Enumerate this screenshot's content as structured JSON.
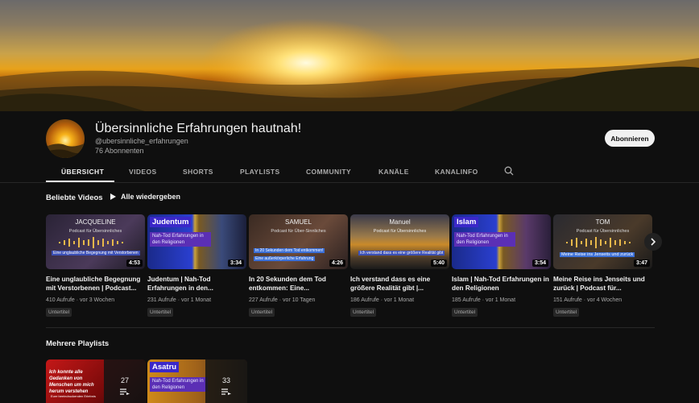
{
  "channel": {
    "title": "Übersinnliche Erfahrungen hautnah!",
    "handle": "@ubersinnliche_erfahrungen",
    "subscribers": "76 Abonnenten",
    "subscribe_label": "Abonnieren"
  },
  "tabs": [
    {
      "label": "ÜBERSICHT",
      "active": true
    },
    {
      "label": "VIDEOS"
    },
    {
      "label": "SHORTS"
    },
    {
      "label": "PLAYLISTS"
    },
    {
      "label": "COMMUNITY"
    },
    {
      "label": "KANÄLE"
    },
    {
      "label": "KANALINFO"
    }
  ],
  "popular": {
    "title": "Beliebte Videos",
    "play_all": "Alle wiedergeben",
    "videos": [
      {
        "thumb_title": "JACQUELINE",
        "thumb_sub": "Podcast für Übersinnliches",
        "thumb_caption": "Eine unglaubliche Begegnung mit Verstorbenen",
        "duration": "4:53",
        "title": "Eine unglaubliche Begegnung mit Verstorbenen | Podcast...",
        "views": "410 Aufrufe",
        "age": "vor 3 Wochen",
        "badge": "Untertitel"
      },
      {
        "thumb_title": "Judentum",
        "thumb_sub": "Nah-Tod Erfahrungen in den Religionen",
        "duration": "3:34",
        "title": "Judentum | Nah-Tod Erfahrungen in den...",
        "views": "231 Aufrufe",
        "age": "vor 1 Monat",
        "badge": "Untertitel"
      },
      {
        "thumb_title": "SAMUEL",
        "thumb_sub": "Podcast für Über-Sinnliches",
        "thumb_caption": "In 20 Sekunden dem Tod entkommen!",
        "thumb_caption2": "Eine außerkörperliche Erfahrung",
        "duration": "4:26",
        "title": "In 20 Sekunden dem Tod entkommen: Eine...",
        "views": "227 Aufrufe",
        "age": "vor 10 Tagen",
        "badge": "Untertitel"
      },
      {
        "thumb_title": "Manuel",
        "thumb_sub": "Podcast für Übersinnliches",
        "thumb_caption": "Ich verstand dass es eine größere Realität gibt",
        "duration": "5:40",
        "title": "Ich verstand dass es eine größere Realität gibt |...",
        "views": "186 Aufrufe",
        "age": "vor 1 Monat",
        "badge": "Untertitel"
      },
      {
        "thumb_title": "Islam",
        "thumb_sub": "Nah-Tod Erfahrungen in den Religionen",
        "duration": "3:54",
        "title": "Islam | Nah-Tod Erfahrungen in den Religionen",
        "views": "185 Aufrufe",
        "age": "vor 1 Monat",
        "badge": "Untertitel"
      },
      {
        "thumb_title": "TOM",
        "thumb_sub": "Podcast für Übersinnliches",
        "thumb_caption": "Meine Reise ins Jenseits und zurück",
        "duration": "3:47",
        "title": "Meine Reise ins Jenseits und zurück | Podcast für...",
        "views": "151 Aufrufe",
        "age": "vor 4 Wochen",
        "badge": "Untertitel"
      }
    ]
  },
  "playlists": {
    "title": "Mehrere Playlists",
    "items": [
      {
        "thumb_text": "Ich konnte alle Gedanken von Menschen um mich herum verstehen",
        "thumb_sub": "Eure beeindruckenden Erlebnis",
        "count": "27"
      },
      {
        "thumb_title": "Asatru",
        "thumb_sub": "Nah-Tod Erfahrungen in den Religionen",
        "count": "33"
      }
    ]
  },
  "colors": {
    "background": "#0f0f0f",
    "accent_purple": "#5b2fb5",
    "accent_blue": "#3b6fd6",
    "text_primary": "#f1f1f1",
    "text_secondary": "#aaaaaa"
  }
}
